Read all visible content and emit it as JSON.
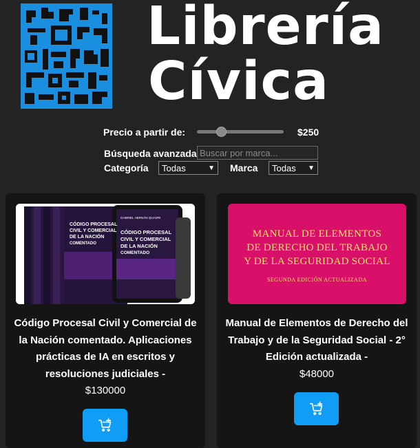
{
  "logo": {
    "line1": "Librería",
    "line2": "Cívica",
    "color": "#1a8fe0"
  },
  "filters": {
    "price_label": "Precio a partir de:",
    "price_value": "$250",
    "price_fraction": 0.25,
    "advanced_label": "Búsqueda avanzada",
    "search_placeholder": "Buscar por marca...",
    "category_label": "Categoría",
    "category_selected": "Todas",
    "brand_label": "Marca",
    "brand_selected": "Todas"
  },
  "products": [
    {
      "title": "Código Procesal Civil y Comercial de la Nación comentado. Aplicaciones prácticas de IA en escritos y resoluciones judiciales -",
      "price": "$130000",
      "cover_lines": [
        "CÓDIGO PROCESAL",
        "CIVIL Y COMERCIAL",
        "DE LA NACIÓN",
        "COMENTADO"
      ],
      "cover_author": "GABRIEL HERNÁN QUADRI"
    },
    {
      "title": "Manual de Elementos de Derecho del Trabajo y de la Seguridad Social - 2° Edición actualizada -",
      "price": "$48000",
      "cover_lines": [
        "MANUAL DE ELEMENTOS",
        "DE DERECHO DEL TRABAJO",
        "Y DE LA SEGURIDAD SOCIAL"
      ],
      "cover_subtitle": "SEGUNDA EDICIÓN ACTUALIZADA"
    }
  ],
  "colors": {
    "background": "#232323",
    "card": "#151515",
    "accent": "#0f9df5",
    "cover2": "#d8106a",
    "cover2_text": "#f7e26b"
  },
  "icons": {
    "cart": "cart-plus-icon"
  }
}
